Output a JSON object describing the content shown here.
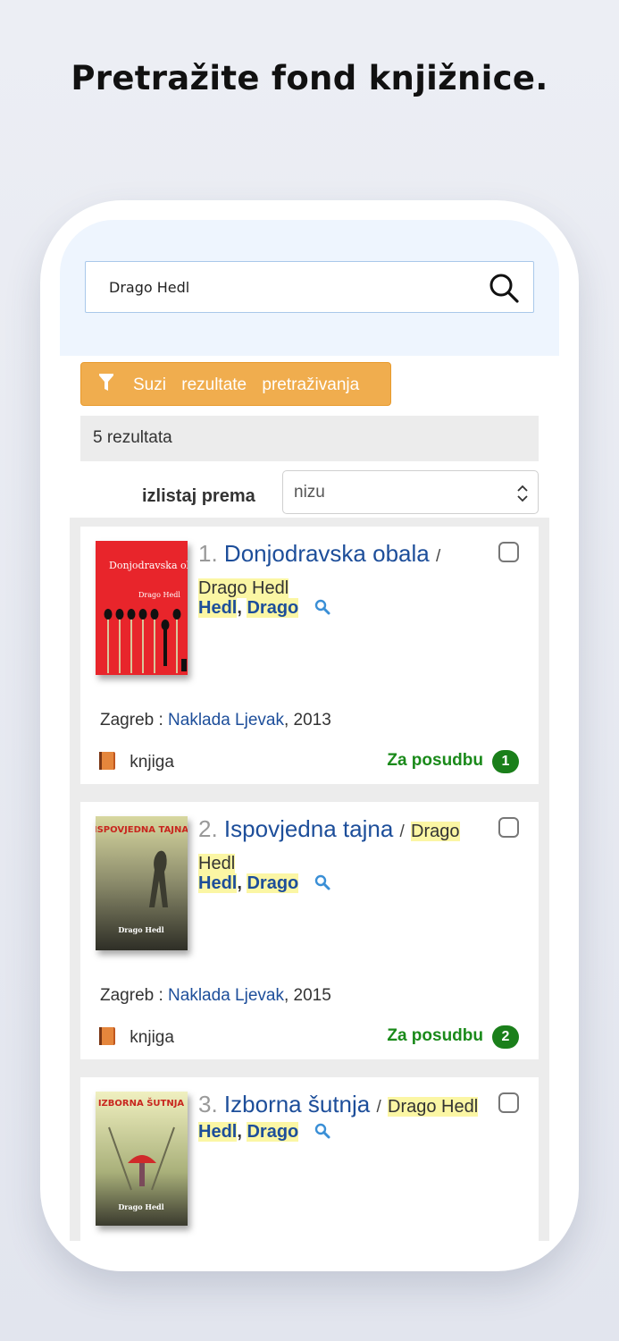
{
  "headline": "Pretražite fond knjižnice.",
  "search": {
    "value": "Drago Hedl"
  },
  "filter": {
    "label": "Suzi rezultate pretraživanja"
  },
  "results_count": "5 rezultata",
  "sort": {
    "label": "izlistaj prema",
    "selected": "nizu"
  },
  "colors": {
    "accent": "#f0ad4e",
    "link": "#1d4e9a",
    "highlight": "#fbf6a4",
    "available": "#1a8a1a"
  },
  "results": [
    {
      "number": "1.",
      "title": "Donjodravska obala",
      "slash": "/",
      "responsibility": "Drago Hedl",
      "author_last": "Hedl",
      "author_sep": ",",
      "author_first": "Drago",
      "cover_icon": "book-cover-matches",
      "cover_title": "Donjodravska obala",
      "cover_author": "Drago Hedl",
      "publication": {
        "place": "Zagreb :",
        "publisher": "Naklada Ljevak",
        "year": ", 2013"
      },
      "type": "knjiga",
      "availability": "Za posudbu",
      "copies": "1"
    },
    {
      "number": "2.",
      "title": "Ispovjedna tajna",
      "slash": "/",
      "responsibility": "Drago Hedl",
      "author_last": "Hedl",
      "author_sep": ",",
      "author_first": "Drago",
      "cover_icon": "book-cover-figure",
      "cover_title": "ISPOVJEDNA TAJNA",
      "cover_author": "Drago Hedl",
      "publication": {
        "place": "Zagreb :",
        "publisher": "Naklada Ljevak",
        "year": ", 2015"
      },
      "type": "knjiga",
      "availability": "Za posudbu",
      "copies": "2"
    },
    {
      "number": "3.",
      "title": "Izborna šutnja",
      "slash": "/",
      "responsibility": "Drago Hedl",
      "author_last": "Hedl",
      "author_sep": ",",
      "author_first": "Drago",
      "cover_icon": "book-cover-umbrella",
      "cover_title": "IZBORNA ŠUTNJA",
      "cover_author": "Drago Hedl"
    }
  ]
}
